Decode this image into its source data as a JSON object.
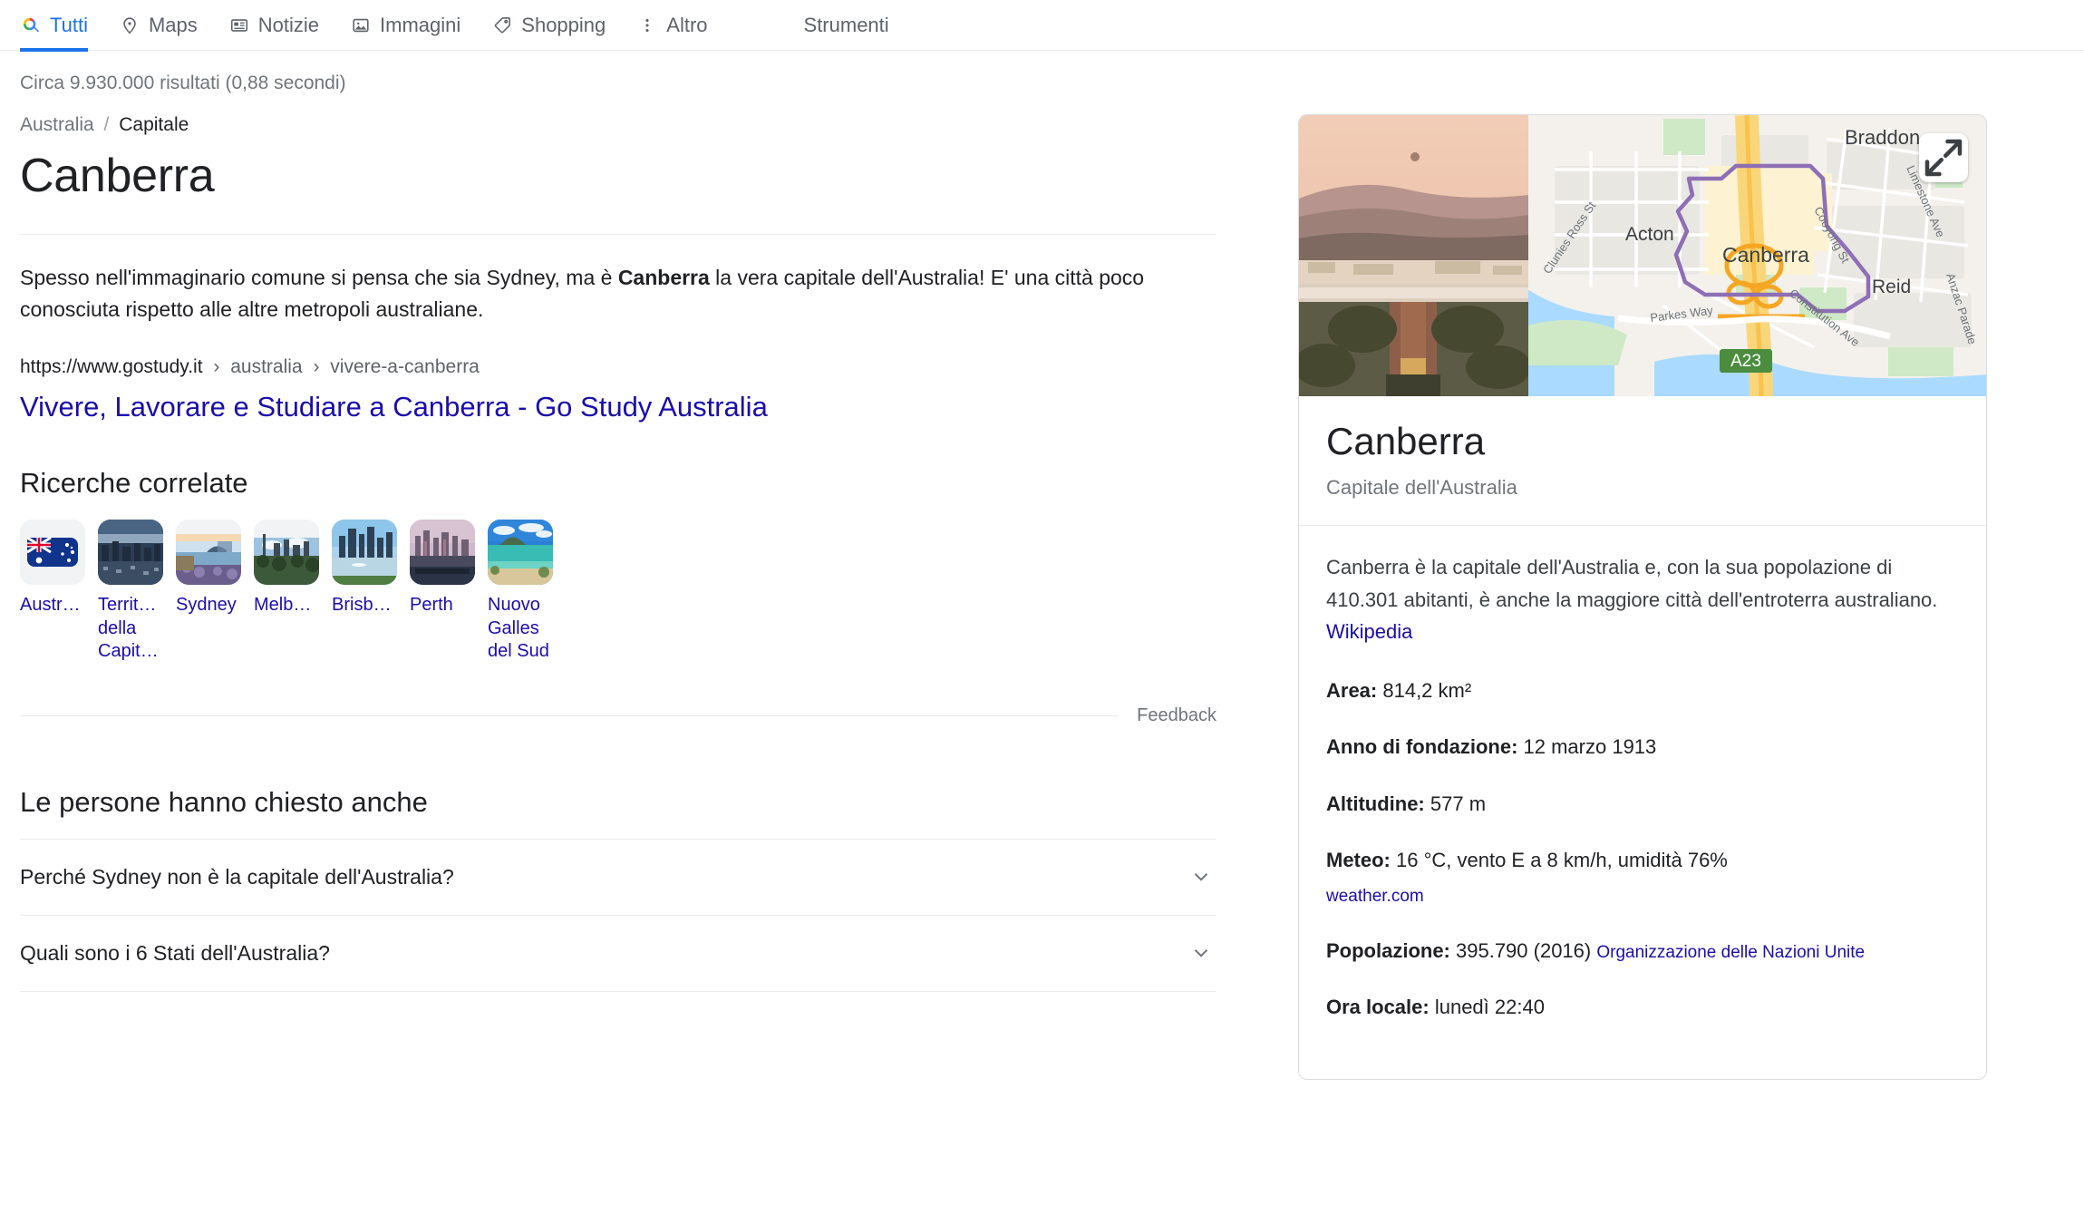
{
  "nav": {
    "items": [
      {
        "label": "Tutti",
        "icon": "google-search-icon",
        "active": true
      },
      {
        "label": "Maps",
        "icon": "map-pin-icon",
        "active": false
      },
      {
        "label": "Notizie",
        "icon": "news-icon",
        "active": false
      },
      {
        "label": "Immagini",
        "icon": "image-icon",
        "active": false
      },
      {
        "label": "Shopping",
        "icon": "tag-icon",
        "active": false
      },
      {
        "label": "Altro",
        "icon": "more-vertical-icon",
        "active": false
      }
    ],
    "tools_label": "Strumenti"
  },
  "result_stats": "Circa 9.930.000 risultati (0,88 secondi)",
  "featured": {
    "breadcrumb_root": "Australia",
    "breadcrumb_sep": "/",
    "breadcrumb_current": "Capitale",
    "title": "Canberra",
    "snippet_pre": "Spesso nell'immaginario comune si pensa che sia Sydney, ma è ",
    "snippet_bold": "Canberra",
    "snippet_post": " la vera capitale dell'Australia! E' una città poco conosciuta rispetto alle altre metropoli australiane.",
    "url_domain": "https://www.gostudy.it",
    "url_seg1": "australia",
    "url_seg2": "vivere-a-canberra",
    "url_chevron": "›",
    "result_title": "Vivere, Lavorare e Studiare a Canberra - Go Study Australia"
  },
  "related": {
    "heading": "Ricerche correlate",
    "items": [
      {
        "label": "Austr…",
        "thumb": "australia-flag-thumb"
      },
      {
        "label": "Territ… della Capit…",
        "thumb": "canberra-city-thumb"
      },
      {
        "label": "Sydney",
        "thumb": "sydney-harbour-thumb"
      },
      {
        "label": "Melb…",
        "thumb": "melbourne-skyline-thumb"
      },
      {
        "label": "Brisb…",
        "thumb": "brisbane-river-thumb"
      },
      {
        "label": "Perth",
        "thumb": "perth-skyline-thumb"
      },
      {
        "label": "Nuovo Galles del Sud",
        "thumb": "nsw-beach-thumb"
      }
    ],
    "feedback_label": "Feedback"
  },
  "people_also_ask": {
    "heading": "Le persone hanno chiesto anche",
    "questions": [
      "Perché Sydney non è la capitale dell'Australia?",
      "Quali sono i 6 Stati dell'Australia?"
    ]
  },
  "knowledge_panel": {
    "title": "Canberra",
    "subtitle": "Capitale dell'Australia",
    "description_pre": "Canberra è la capitale dell'Australia e, con la sua popolazione di 410.301 abitanti, è anche la maggiore città dell'entroterra australiano. ",
    "description_source": "Wikipedia",
    "map_labels": {
      "braddon": "Braddon",
      "acton": "Acton",
      "canberra": "Canberra",
      "reid": "Reid",
      "clunies_ross": "Clunies Ross St",
      "cooyong": "Cooyong St",
      "limestone": "Limestone Ave",
      "constitution": "Constitution Ave",
      "anzac": "Anzac Parade",
      "parkes": "Parkes Way",
      "highway_shield": "A23"
    },
    "facts": [
      {
        "label": "Area:",
        "value": " 814,2 km²"
      },
      {
        "label": "Anno di fondazione:",
        "value": " 12 marzo 1913"
      },
      {
        "label": "Altitudine:",
        "value": " 577 m"
      },
      {
        "label": "Meteo:",
        "value": " 16 °C, vento E a 8 km/h, umidità 76%",
        "source": "weather.com"
      },
      {
        "label": "Popolazione:",
        "value": " 395.790 (2016) ",
        "source_inline": "Organizzazione delle Nazioni Unite"
      },
      {
        "label": "Ora locale:",
        "value": " lunedì 22:40"
      }
    ]
  },
  "colors": {
    "accent_blue": "#1a73e8",
    "link_blue": "#1a0dab",
    "text_primary": "#202124",
    "text_secondary": "#70757a",
    "border": "#dadce0"
  }
}
